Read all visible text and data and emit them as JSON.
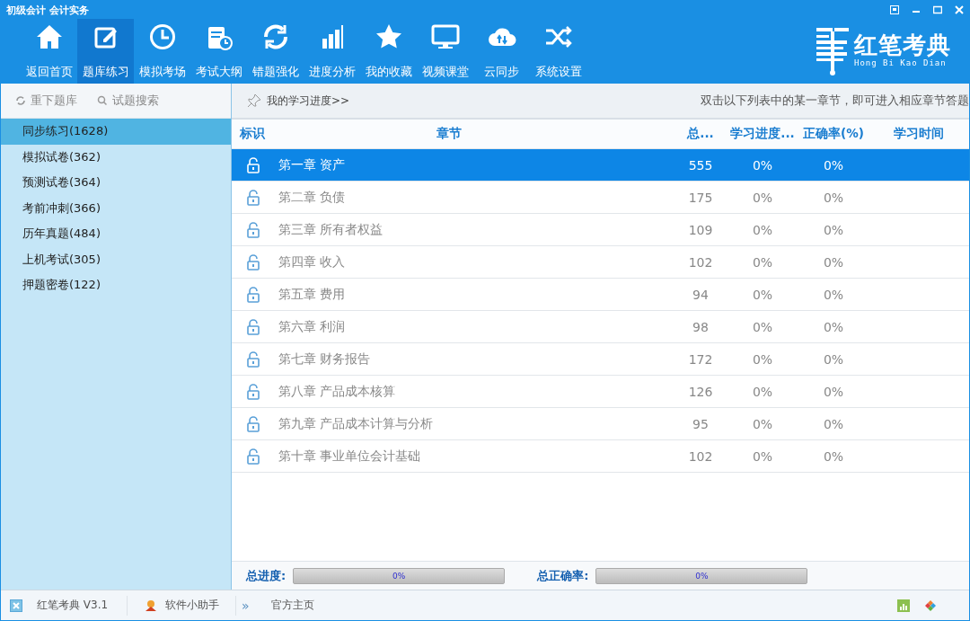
{
  "window": {
    "title": "初级会计 会计实务"
  },
  "toolbar": [
    {
      "label": "返回首页",
      "selected": false
    },
    {
      "label": "题库练习",
      "selected": true
    },
    {
      "label": "模拟考场",
      "selected": false
    },
    {
      "label": "考试大纲",
      "selected": false
    },
    {
      "label": "错题强化",
      "selected": false
    },
    {
      "label": "进度分析",
      "selected": false
    },
    {
      "label": "我的收藏",
      "selected": false
    },
    {
      "label": "视频课堂",
      "selected": false
    },
    {
      "label": "云同步",
      "selected": false
    },
    {
      "label": "系统设置",
      "selected": false
    }
  ],
  "logo": {
    "name": "红笔考典",
    "pinyin": "Hong Bi Kao Dian"
  },
  "sidebar": {
    "actions": [
      "重下题库",
      "试题搜索"
    ],
    "items": [
      {
        "label": "同步练习(1628)",
        "selected": true
      },
      {
        "label": "模拟试卷(362)",
        "selected": false
      },
      {
        "label": "预测试卷(364)",
        "selected": false
      },
      {
        "label": "考前冲刺(366)",
        "selected": false
      },
      {
        "label": "历年真题(484)",
        "selected": false
      },
      {
        "label": "上机考试(305)",
        "selected": false
      },
      {
        "label": "押题密卷(122)",
        "selected": false
      }
    ]
  },
  "header": {
    "progress_link": "我的学习进度>>",
    "hint": "双击以下列表中的某一章节，即可进入相应章节答题"
  },
  "table": {
    "columns": [
      "标识",
      "章节",
      "总...",
      "学习进度...",
      "正确率(%)",
      "学习时间"
    ],
    "rows": [
      {
        "chapter": "第一章 资产",
        "total": "555",
        "progress": "0%",
        "accuracy": "0%",
        "selected": true
      },
      {
        "chapter": "第二章 负债",
        "total": "175",
        "progress": "0%",
        "accuracy": "0%",
        "selected": false
      },
      {
        "chapter": "第三章 所有者权益",
        "total": "109",
        "progress": "0%",
        "accuracy": "0%",
        "selected": false
      },
      {
        "chapter": "第四章 收入",
        "total": "102",
        "progress": "0%",
        "accuracy": "0%",
        "selected": false
      },
      {
        "chapter": "第五章 费用",
        "total": "94",
        "progress": "0%",
        "accuracy": "0%",
        "selected": false
      },
      {
        "chapter": "第六章 利润",
        "total": "98",
        "progress": "0%",
        "accuracy": "0%",
        "selected": false
      },
      {
        "chapter": "第七章 财务报告",
        "total": "172",
        "progress": "0%",
        "accuracy": "0%",
        "selected": false
      },
      {
        "chapter": "第八章 产品成本核算",
        "total": "126",
        "progress": "0%",
        "accuracy": "0%",
        "selected": false
      },
      {
        "chapter": "第九章 产品成本计算与分析",
        "total": "95",
        "progress": "0%",
        "accuracy": "0%",
        "selected": false
      },
      {
        "chapter": "第十章 事业单位会计基础",
        "total": "102",
        "progress": "0%",
        "accuracy": "0%",
        "selected": false
      }
    ]
  },
  "summary": [
    {
      "label": "总进度:",
      "level": 0,
      "reading": "0%"
    },
    {
      "label": "总正确率:",
      "level": 0,
      "reading": "0%"
    }
  ],
  "status_bar": {
    "version": "红笔考典 V3.1",
    "helper": "软件小助手",
    "more": "»",
    "homepage": "官方主页"
  }
}
